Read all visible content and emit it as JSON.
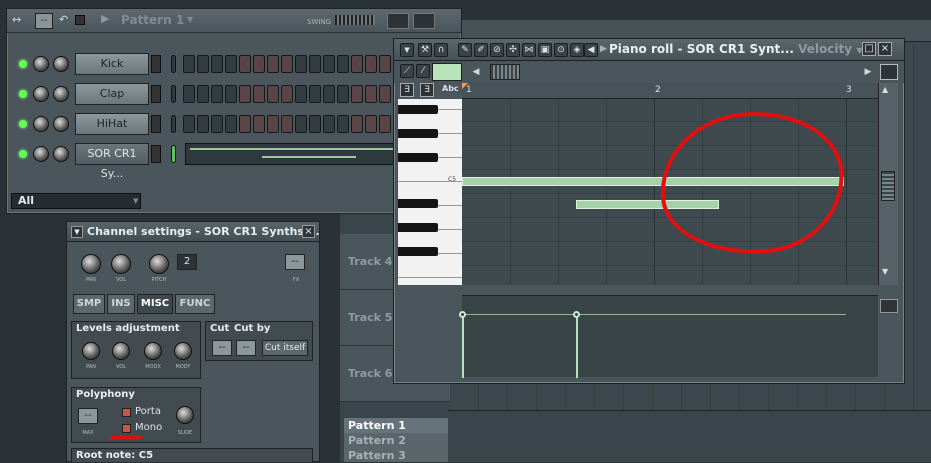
{
  "step_sequencer": {
    "pattern_name": "Pattern 1",
    "swing_label": "SWING",
    "pane_value": "--",
    "filter_label": "All",
    "channels": [
      {
        "name": "Kick",
        "selected": false
      },
      {
        "name": "Clap",
        "selected": false
      },
      {
        "name": "HiHat",
        "selected": false
      },
      {
        "name": "SOR CR1 Sy...",
        "selected": true
      }
    ]
  },
  "channel_settings": {
    "title": "Channel settings - SOR CR1 Synths 0...",
    "close": "×",
    "top_knobs": [
      "PAN",
      "VOL",
      "PITCH"
    ],
    "pitch_value": "2",
    "fx_label": "FX",
    "fx_value": "--",
    "tabs": [
      {
        "label": "SMP",
        "selected": false
      },
      {
        "label": "INS",
        "selected": false
      },
      {
        "label": "MISC",
        "selected": true
      },
      {
        "label": "FUNC",
        "selected": false
      }
    ],
    "levels": {
      "title": "Levels adjustment",
      "knobs": [
        "PAN",
        "VOL",
        "MODX",
        "MODY"
      ]
    },
    "cut": {
      "cut_label": "Cut",
      "cut_by_label": "Cut by",
      "cut_value": "--",
      "cut_by_value": "--",
      "cut_itself": "Cut itself"
    },
    "polyphony": {
      "title": "Polyphony",
      "max_label": "MAX",
      "max_value": "--",
      "porta": "Porta",
      "mono": "Mono",
      "slide": "SLIDE"
    },
    "root_note": "Root note: C5"
  },
  "piano_roll": {
    "title": "Piano roll - SOR CR1 Synt...",
    "target": "Velocity",
    "ruler_marks": [
      "1",
      "2",
      "3"
    ],
    "key_label": "C5",
    "abc": "Abc"
  },
  "playlist": {
    "tracks": [
      "Track 4",
      "Track 5",
      "Track 6"
    ],
    "patterns": [
      "Pattern 1",
      "Pattern 2",
      "Pattern 3"
    ]
  },
  "colors": {
    "annotation": "#e01010",
    "note": "#a5d2a9",
    "led": "#60ff50"
  }
}
